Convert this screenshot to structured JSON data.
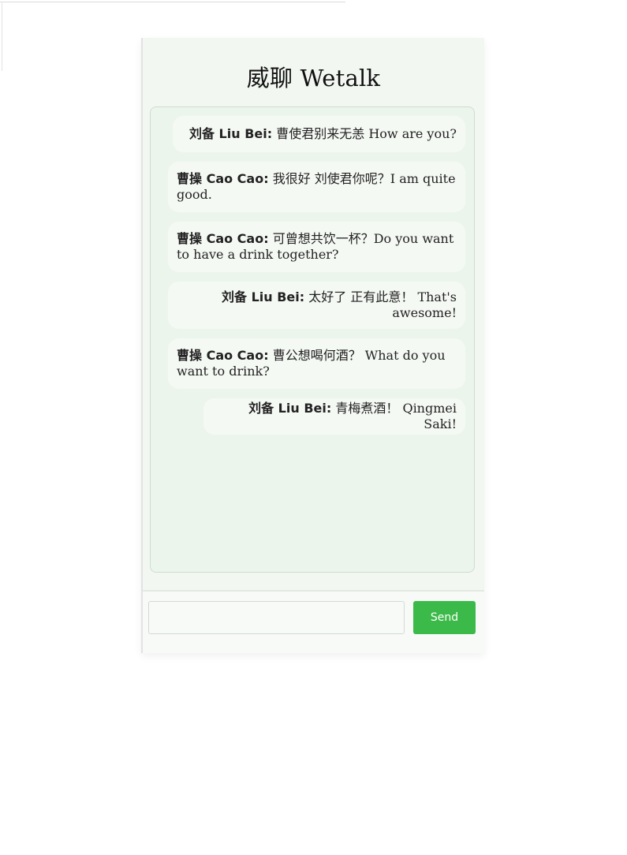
{
  "app": {
    "title": "威聊 Wetalk"
  },
  "messages": [
    {
      "sender": "刘备 Liu Bei:",
      "text": "曹使君别来无恙 How are you?",
      "align": "right"
    },
    {
      "sender": "曹操 Cao Cao:",
      "text": "我很好 刘使君你呢？I am quite good.",
      "align": "left"
    },
    {
      "sender": "曹操 Cao Cao:",
      "text": "可曾想共饮一杯？Do you want to have a drink together?",
      "align": "left"
    },
    {
      "sender": "刘备 Liu Bei:",
      "text": "太好了 正有此意！ That's awesome!",
      "align": "right"
    },
    {
      "sender": "曹操 Cao Cao:",
      "text": "曹公想喝何酒？ What do you want to drink?",
      "align": "left"
    },
    {
      "sender": "刘备 Liu Bei:",
      "text": "青梅煮酒！ Qingmei Saki!",
      "align": "right"
    }
  ],
  "composer": {
    "input_value": "",
    "input_placeholder": "",
    "send_label": "Send"
  },
  "colors": {
    "accent": "#3cba49",
    "chat_background": "#ecf5ec",
    "bubble": "#f5f9f4"
  }
}
